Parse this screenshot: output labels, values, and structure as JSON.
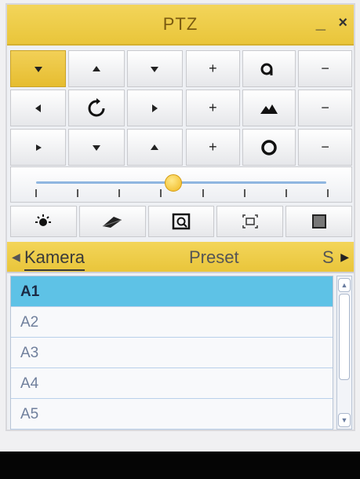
{
  "window": {
    "title": "PTZ",
    "minimize_label": "_",
    "close_label": "×"
  },
  "direction_pad": {
    "buttons": [
      {
        "name": "up-left",
        "icon": "arrow-up-left-icon",
        "active": true
      },
      {
        "name": "up",
        "icon": "arrow-up-icon"
      },
      {
        "name": "up-right",
        "icon": "arrow-up-right-icon"
      },
      {
        "name": "left",
        "icon": "arrow-left-icon"
      },
      {
        "name": "auto-rotate",
        "icon": "rotate-icon"
      },
      {
        "name": "right",
        "icon": "arrow-right-icon"
      },
      {
        "name": "down-left",
        "icon": "arrow-down-left-icon"
      },
      {
        "name": "down",
        "icon": "arrow-down-icon"
      },
      {
        "name": "down-right",
        "icon": "arrow-down-right-icon"
      }
    ]
  },
  "lens_controls": {
    "rows": [
      {
        "name": "zoom",
        "plus": "+",
        "icon": "zoom-icon",
        "minus": "−"
      },
      {
        "name": "focus",
        "plus": "+",
        "icon": "focus-icon",
        "minus": "−"
      },
      {
        "name": "iris",
        "plus": "+",
        "icon": "iris-icon",
        "minus": "−"
      }
    ]
  },
  "speed_slider": {
    "value_fraction": 0.47,
    "tick_count": 8
  },
  "functions": [
    {
      "name": "light",
      "icon": "light-icon"
    },
    {
      "name": "wiper",
      "icon": "wiper-icon"
    },
    {
      "name": "3d-zoom",
      "icon": "3d-zoom-icon"
    },
    {
      "name": "center",
      "icon": "center-icon"
    },
    {
      "name": "menu",
      "icon": "menu-icon"
    }
  ],
  "tabs": {
    "left_arrow": "◀",
    "right_arrow": "▶",
    "items": [
      "Kamera",
      "Preset",
      "S"
    ],
    "active": "Kamera"
  },
  "camera_list": {
    "items": [
      "A1",
      "A2",
      "A3",
      "A4",
      "A5"
    ],
    "selected": "A1"
  },
  "colors": {
    "accent": "#e9c53a",
    "selection": "#5ec2e6"
  }
}
